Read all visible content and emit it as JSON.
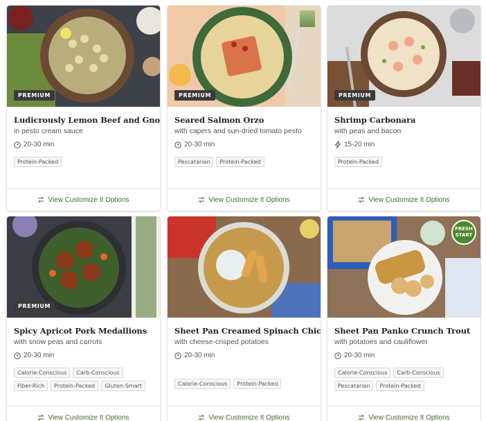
{
  "colors": {
    "accent_green": "#3d6a2d",
    "premium_badge": "#3a3a3a",
    "fresh_start_badge": "#4b8a2a"
  },
  "cards": [
    {
      "premium": "PREMIUM",
      "title": "Ludicrously Lemon Beef and Gnocchi",
      "subtitle": "in pesto cream sauce",
      "time": "20-30 min",
      "time_icon": "clock-icon",
      "tags": [
        "Protein-Packed"
      ],
      "cta": "View Customize It Options"
    },
    {
      "premium": "PREMIUM",
      "title": "Seared Salmon Orzo",
      "subtitle": "with capers and sun-dried tomato pesto",
      "time": "20-30 min",
      "time_icon": "clock-icon",
      "tags": [
        "Pescatarian",
        "Protein-Packed"
      ],
      "cta": "View Customize It Options"
    },
    {
      "premium": "PREMIUM",
      "title": "Shrimp Carbonara",
      "subtitle": "with peas and bacon",
      "time": "15-20 min",
      "time_icon": "lightning-icon",
      "tags": [
        "Protein-Packed"
      ],
      "cta": "View Customize It Options"
    },
    {
      "premium": "PREMIUM",
      "title": "Spicy Apricot Pork Medallions",
      "subtitle": "with snow peas and carrots",
      "time": "20-30 min",
      "time_icon": "clock-icon",
      "tags": [
        "Calorie-Conscious",
        "Carb-Conscious",
        "Fiber-Rich",
        "Protein-Packed",
        "Gluten-Smart"
      ],
      "cta": "View Customize It Options"
    },
    {
      "premium": "",
      "title": "Sheet Pan Creamed Spinach Chicken",
      "subtitle": "with cheese-crisped potatoes",
      "time": "20-30 min",
      "time_icon": "clock-icon",
      "tags": [
        "Calorie-Conscious",
        "Protein-Packed"
      ],
      "cta": "View Customize It Options"
    },
    {
      "premium": "",
      "title": "Sheet Pan Panko Crunch Trout",
      "subtitle": "with potatoes and cauliflower",
      "time": "20-30 min",
      "time_icon": "clock-icon",
      "tags": [
        "Calorie-Conscious",
        "Carb-Conscious",
        "Pescatarian",
        "Protein-Packed"
      ],
      "fresh_badge": "FRESH START",
      "cta": "View Customize It Options"
    }
  ]
}
